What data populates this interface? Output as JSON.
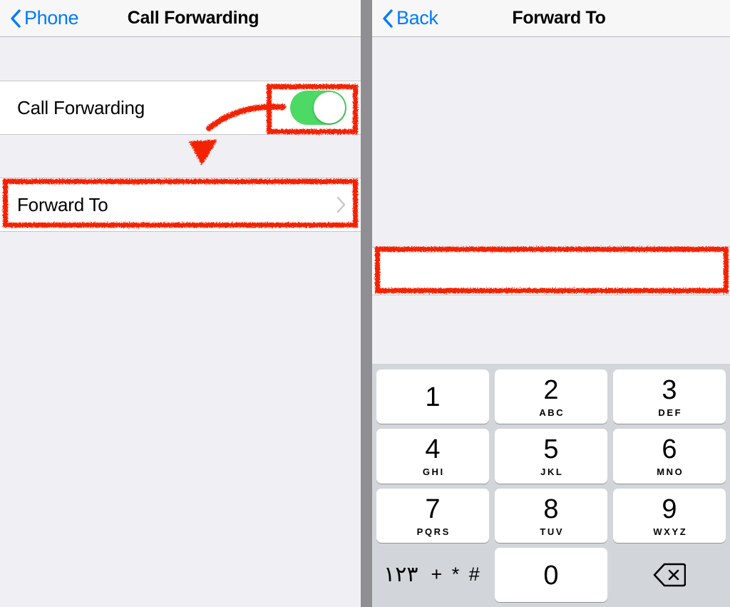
{
  "left_panel": {
    "nav": {
      "back_label": "Phone",
      "back_icon": "chevron-left-icon",
      "title": "Call Forwarding"
    },
    "rows": [
      {
        "label": "Call Forwarding",
        "control": "toggle",
        "toggle_state": "on",
        "toggle_color": "#4CD964"
      },
      {
        "label": "Forward To",
        "control": "disclosure",
        "disclosure_icon": "chevron-right-icon"
      }
    ]
  },
  "right_panel": {
    "nav": {
      "back_label": "Back",
      "back_icon": "chevron-left-icon",
      "title": "Forward To"
    },
    "phone_field": {
      "value": "",
      "placeholder": ""
    },
    "keypad": {
      "rows": [
        [
          {
            "digit": "1",
            "letters": ""
          },
          {
            "digit": "2",
            "letters": "ABC"
          },
          {
            "digit": "3",
            "letters": "DEF"
          }
        ],
        [
          {
            "digit": "4",
            "letters": "GHI"
          },
          {
            "digit": "5",
            "letters": "JKL"
          },
          {
            "digit": "6",
            "letters": "MNO"
          }
        ],
        [
          {
            "digit": "7",
            "letters": "PQRS"
          },
          {
            "digit": "8",
            "letters": "TUV"
          },
          {
            "digit": "9",
            "letters": "WXYZ"
          }
        ]
      ],
      "bottom_row": {
        "alt_numerals": "١٢٣",
        "symbols": "+ * #",
        "zero": "0",
        "delete_icon": "backspace-delete-icon"
      }
    }
  },
  "annotations": {
    "color": "#F42000",
    "highlight_toggle": "call-forwarding-toggle",
    "highlight_forward_to": "forward-to-row",
    "highlight_phone_field": "phone-number-field",
    "arrow": "curved-arrow-pointing-down"
  }
}
